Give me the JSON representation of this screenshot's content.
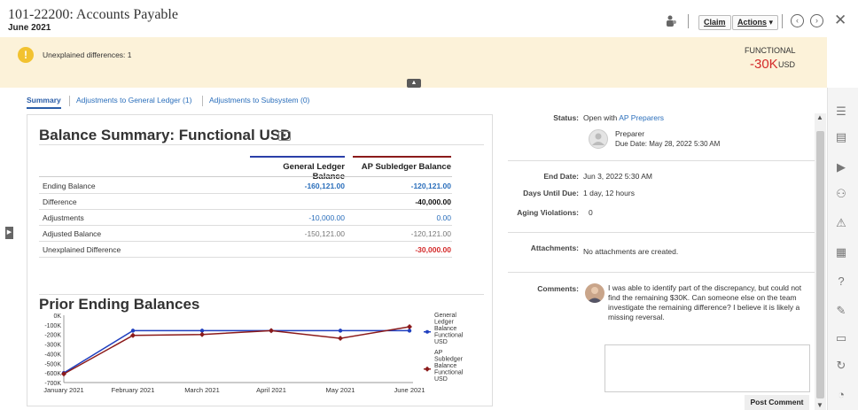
{
  "header": {
    "title": "101-22200: Accounts Payable",
    "period": "June 2021",
    "claim_label": "Claim",
    "actions_label": "Actions"
  },
  "banner": {
    "warning_text": "Unexplained differences: 1",
    "functional_label": "FUNCTIONAL",
    "functional_value": "-30K",
    "functional_currency": "USD"
  },
  "tabs": [
    {
      "label": "Summary"
    },
    {
      "label": "Adjustments to General Ledger (1)"
    },
    {
      "label": "Adjustments to Subsystem (0)"
    }
  ],
  "balance_summary": {
    "title": "Balance Summary: Functional USD",
    "columns": [
      "General Ledger Balance",
      "AP Subledger Balance"
    ],
    "rows": [
      {
        "label": "Ending Balance",
        "gl": "-160,121.00",
        "ap": "-120,121.00"
      },
      {
        "label": "Difference",
        "gl": "",
        "ap": "-40,000.00"
      },
      {
        "label": "Adjustments",
        "gl": "-10,000.00",
        "ap": "0.00"
      },
      {
        "label": "Adjusted Balance",
        "gl": "-150,121.00",
        "ap": "-120,121.00"
      },
      {
        "label": "Unexplained Difference",
        "gl": "",
        "ap": "-30,000.00"
      }
    ]
  },
  "chart_data": {
    "type": "line",
    "title": "Prior Ending Balances",
    "categories": [
      "January 2021",
      "February 2021",
      "March 2021",
      "April 2021",
      "May 2021",
      "June 2021"
    ],
    "y_ticks": [
      "0K",
      "-100K",
      "-200K",
      "-300K",
      "-400K",
      "-500K",
      "-600K",
      "-700K"
    ],
    "ylim": [
      -700000,
      0
    ],
    "series": [
      {
        "name": "General Ledger Balance Functional USD",
        "color": "#1f3fbf",
        "values": [
          -600000,
          -160121,
          -160121,
          -160121,
          -160121,
          -160121
        ]
      },
      {
        "name": "AP Subledger Balance Functional USD",
        "color": "#8b1a1a",
        "values": [
          -610000,
          -210000,
          -200000,
          -160000,
          -240000,
          -120121
        ]
      }
    ],
    "legend_position": "right"
  },
  "details": {
    "status_label": "Status:",
    "status_value": "Open with",
    "status_link": "AP Preparers",
    "preparer_role": "Preparer",
    "preparer_due": "Due Date: May 28, 2022 5:30 AM",
    "end_date_label": "End Date:",
    "end_date_value": "Jun 3, 2022 5:30 AM",
    "days_label": "Days Until Due:",
    "days_value": "1 day, 12 hours",
    "aging_label": "Aging Violations:",
    "aging_value": "0",
    "attachments_label": "Attachments:",
    "attachments_value": "No attachments are created.",
    "comments_label": "Comments:",
    "comment_text": "I was able to identify part of the discrepancy, but could not find the remaining $30K. Can someone else on the team investigate the remaining difference? I believe it is likely a missing reversal.",
    "post_label": "Post Comment"
  }
}
